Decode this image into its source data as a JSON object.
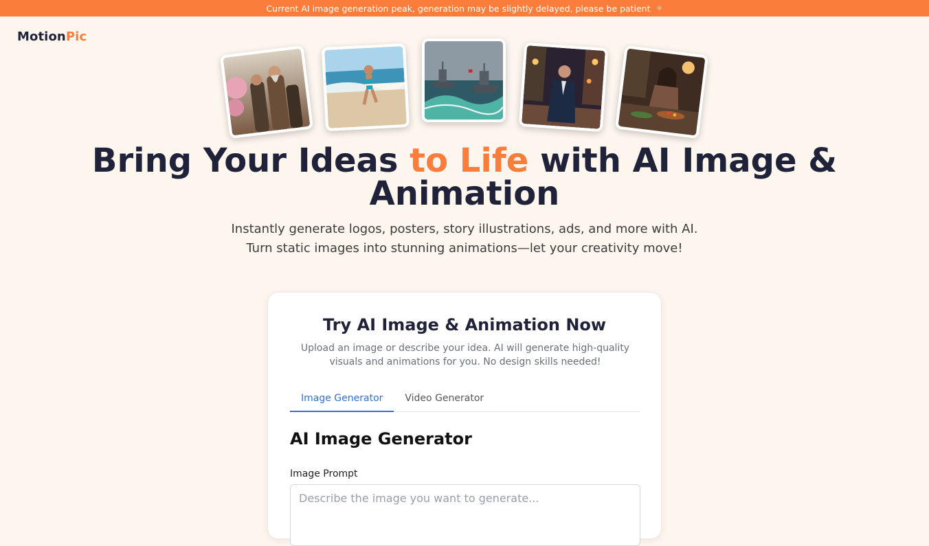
{
  "banner": {
    "text": "Current AI image generation peak, generation may be slightly delayed, please be patient",
    "icon": "diamond-icon"
  },
  "logo": {
    "part1": "Motion",
    "part2": "Pic",
    "accent_color": "#fa7d3c"
  },
  "gallery": [
    {
      "name": "robed-elders-photo"
    },
    {
      "name": "beach-runner-photo"
    },
    {
      "name": "warships-photo"
    },
    {
      "name": "street-man-photo"
    },
    {
      "name": "cooking-woman-photo"
    }
  ],
  "hero": {
    "title_part1": "Bring Your Ideas ",
    "title_accent": "to Life",
    "title_part2": " with AI Image & Animation",
    "subtitle": "Instantly generate logos, posters, story illustrations, ads, and more with AI. Turn static images into stunning animations—let your creativity move!"
  },
  "panel": {
    "title": "Try AI Image & Animation Now",
    "description": "Upload an image or describe your idea. AI will generate high-quality visuals and animations for you. No design skills needed!",
    "tabs": [
      {
        "label": "Image Generator",
        "active": true
      },
      {
        "label": "Video Generator",
        "active": false
      }
    ],
    "section_title": "AI Image Generator",
    "prompt_label": "Image Prompt",
    "prompt_placeholder": "Describe the image you want to generate...",
    "prompt_value": ""
  },
  "colors": {
    "accent": "#fa7d3c",
    "tab_active": "#2f6fd1",
    "background": "#fdf6ef"
  }
}
